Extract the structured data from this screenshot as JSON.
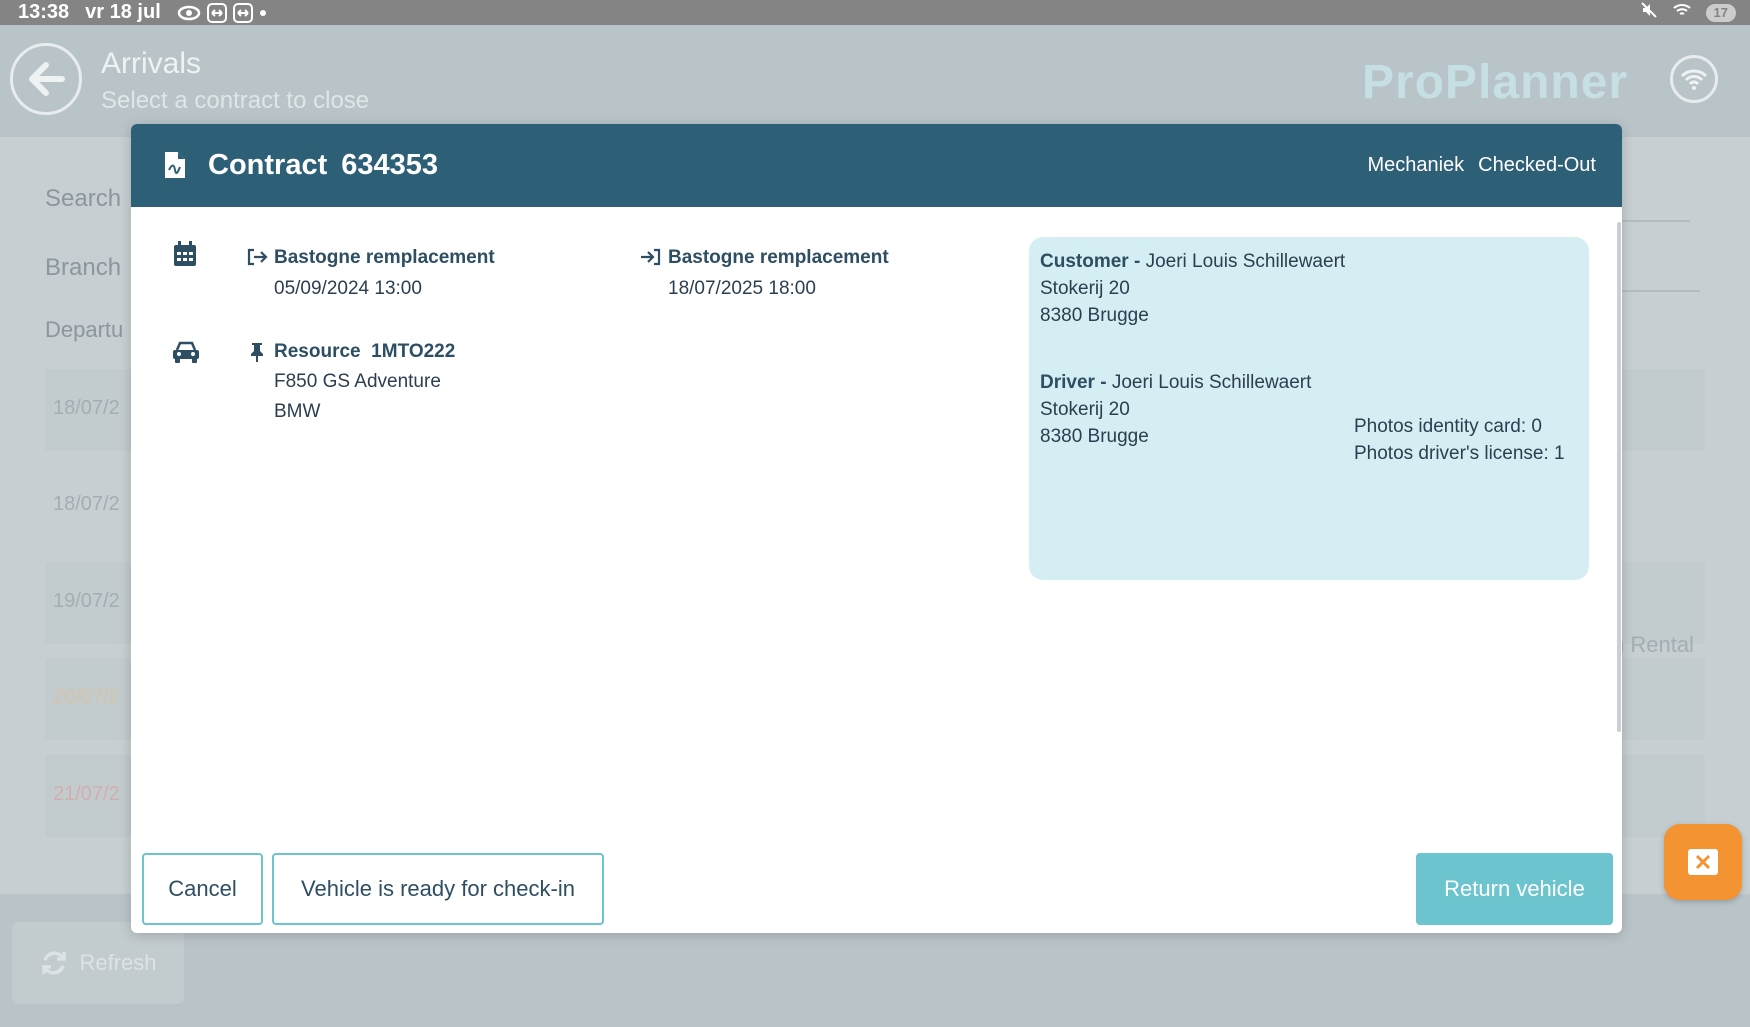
{
  "statusbar": {
    "time": "13:38",
    "date": "vr 18 jul",
    "battery": "17"
  },
  "app": {
    "title": "Arrivals",
    "subtitle": "Select a contract to close",
    "brand": "ProPlanner"
  },
  "background": {
    "search_label": "Search",
    "branch_label": "Branch",
    "departure_label": "Departu",
    "rows": [
      "18/07/2",
      "18/07/2",
      "19/07/2",
      "20/07/2",
      "21/07/2"
    ],
    "rental_text": "n Rental",
    "refresh_label": "Refresh"
  },
  "modal": {
    "title_prefix": "Contract",
    "contract_number": "634353",
    "tags": [
      "Mechaniek",
      "Checked-Out"
    ],
    "departure": {
      "location": "Bastogne remplacement",
      "datetime": "05/09/2024 13:00"
    },
    "arrival": {
      "location": "Bastogne remplacement",
      "datetime": "18/07/2025 18:00"
    },
    "resource": {
      "label": "Resource",
      "code": "1MTO222",
      "model": "F850 GS Adventure",
      "brand": "BMW"
    },
    "customer": {
      "label": "Customer -",
      "name": "Joeri Louis Schillewaert",
      "street": "Stokerij 20",
      "city": "8380 Brugge"
    },
    "driver": {
      "label": "Driver -",
      "name": "Joeri Louis Schillewaert",
      "street": "Stokerij 20",
      "city": "8380 Brugge"
    },
    "photos": {
      "identity_card": "Photos identity card: 0",
      "drivers_license": "Photos driver's license: 1"
    },
    "buttons": {
      "cancel": "Cancel",
      "ready": "Vehicle is ready for check-in",
      "return": "Return vehicle"
    }
  },
  "colors": {
    "header": "#2d5f77",
    "accent": "#6cc4cf",
    "infobox": "#d4eef3",
    "fab": "#f39332"
  }
}
